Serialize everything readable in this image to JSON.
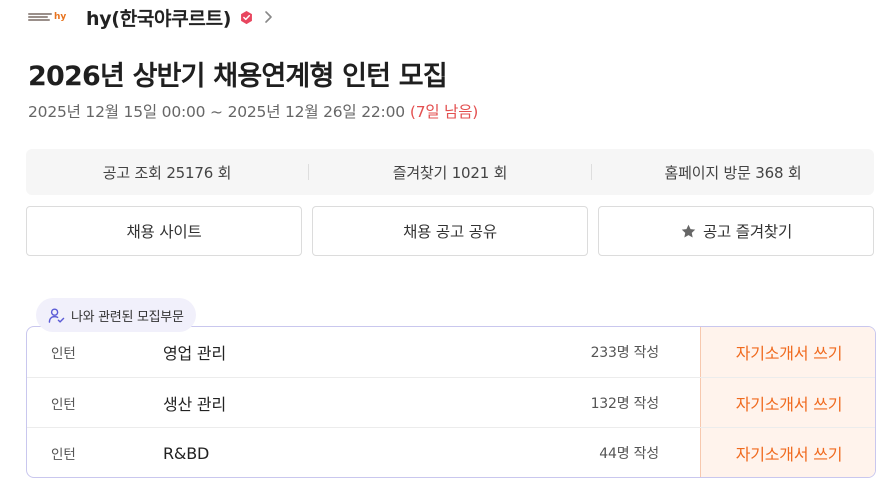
{
  "company": {
    "name": "hy(한국야쿠르트)",
    "logo_text": "hy"
  },
  "posting": {
    "title": "2026년 상반기 채용연계형 인턴 모집",
    "period": "2025년 12월 15일 00:00 ~ 2025년 12월 26일 22:00",
    "remaining": "(7일 남음)"
  },
  "stats": [
    {
      "label": "공고 조회 25176 회"
    },
    {
      "label": "즐겨찾기 1021 회"
    },
    {
      "label": "홈페이지 방문 368 회"
    }
  ],
  "buttons": {
    "site": "채용 사이트",
    "share": "채용 공고 공유",
    "favorite": "공고 즐겨찾기"
  },
  "related": {
    "label": "나와 관련된 모집부문"
  },
  "positions": [
    {
      "type": "인턴",
      "name": "영업 관리",
      "count": "233명 작성",
      "action": "자기소개서 쓰기"
    },
    {
      "type": "인턴",
      "name": "생산 관리",
      "count": "132명 작성",
      "action": "자기소개서 쓰기"
    },
    {
      "type": "인턴",
      "name": "R&BD",
      "count": "44명 작성",
      "action": "자기소개서 쓰기"
    }
  ],
  "colors": {
    "accent_orange": "#f06a1e",
    "remaining_red": "#e35050",
    "verified_badge": "#e8465f"
  }
}
